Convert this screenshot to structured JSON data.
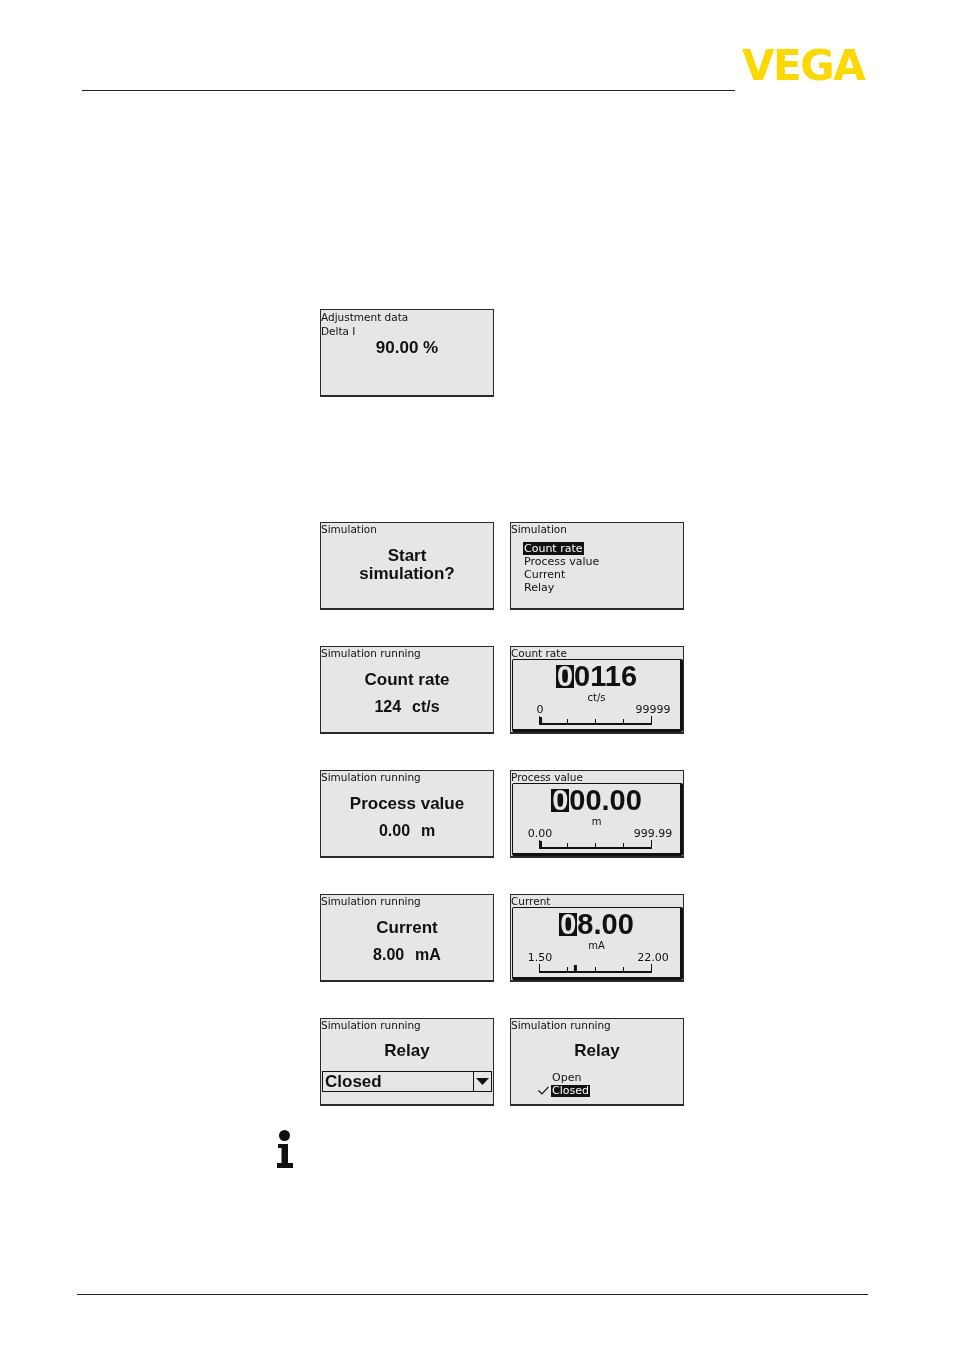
{
  "header": {
    "logo": "VEGA"
  },
  "figures": [
    {
      "rows": [
        {
          "displays": [
            {
              "kind": "value",
              "title": "Adjustment data",
              "parameter": "Delta I",
              "value": "90.00 %"
            }
          ]
        }
      ]
    },
    {
      "rows": [
        {
          "displays": [
            {
              "kind": "prompt",
              "title": "Simulation",
              "message": "Start simulation?"
            },
            {
              "kind": "menu",
              "title": "Simulation",
              "items": [
                {
                  "label": "Count rate",
                  "selected": true
                },
                {
                  "label": "Process value",
                  "selected": false
                },
                {
                  "label": "Current",
                  "selected": false
                },
                {
                  "label": "Relay",
                  "selected": false
                }
              ]
            }
          ]
        },
        {
          "displays": [
            {
              "kind": "status",
              "title": "Simulation running",
              "label": "Count rate",
              "reading": "124 ct/s"
            },
            {
              "kind": "editor",
              "title": "Count rate",
              "value_parts": [
                {
                  "text": "0",
                  "selected": true
                },
                {
                  "text": "0116",
                  "selected": false
                }
              ],
              "unit": "ct/s",
              "min": "0",
              "max": "99999",
              "level": 0.001
            }
          ]
        },
        {
          "displays": [
            {
              "kind": "status",
              "title": "Simulation running",
              "label": "Process value",
              "reading": "0.00 m"
            },
            {
              "kind": "editor",
              "title": "Process value",
              "value_parts": [
                {
                  "text": "0",
                  "selected": true
                },
                {
                  "text": "00.00",
                  "selected": false
                }
              ],
              "unit": "m",
              "min": "0.00",
              "max": "999.99",
              "level": 0
            }
          ]
        },
        {
          "displays": [
            {
              "kind": "status",
              "title": "Simulation running",
              "label": "Current",
              "reading": "8.00 mA"
            },
            {
              "kind": "editor",
              "title": "Current",
              "value_parts": [
                {
                  "text": "0",
                  "selected": true
                },
                {
                  "text": "8.00",
                  "selected": false
                }
              ],
              "unit": "mA",
              "min": "1.50",
              "max": "22.00",
              "level": 0.317
            }
          ]
        },
        {
          "displays": [
            {
              "kind": "dropdown",
              "title": "Simulation running",
              "label": "Relay",
              "value": "Closed"
            },
            {
              "kind": "options",
              "title": "Simulation running",
              "label": "Relay",
              "options": [
                {
                  "label": "Open",
                  "selected": false,
                  "checked": false
                },
                {
                  "label": "Closed",
                  "selected": true,
                  "checked": true
                }
              ]
            }
          ]
        }
      ]
    }
  ]
}
